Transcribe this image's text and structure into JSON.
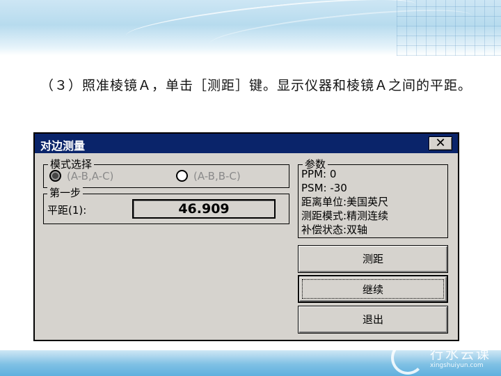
{
  "slide": {
    "paragraph": "（３）照准棱镜Ａ，单击［测距］键。显示仪器和棱镜Ａ之间的平距。",
    "watermark_title": "行水云课",
    "watermark_url": "xingshuiyun.com"
  },
  "dialog": {
    "title": "对边测量",
    "close_label": "✕",
    "mode_group": {
      "label": "模式选择",
      "options": [
        {
          "label": "(A-B,A-C)",
          "selected": true
        },
        {
          "label": "(A-B,B-C)",
          "selected": false
        }
      ]
    },
    "step_group": {
      "label": "第一步",
      "field_label": "平距(1):",
      "field_value": "46.909"
    },
    "params_group": {
      "label": "参数",
      "lines": [
        "PPM:   0",
        "PSM: -30",
        "距离单位:美国英尺",
        "测距模式:精测连续",
        "补偿状态:双轴"
      ]
    },
    "buttons": {
      "measure": "测距",
      "continue": "继续",
      "exit": "退出"
    }
  },
  "colors": {
    "titlebar": "#0a246a",
    "dialog_bg": "#d6d3ce",
    "disabled_text": "#8a8a8a"
  }
}
